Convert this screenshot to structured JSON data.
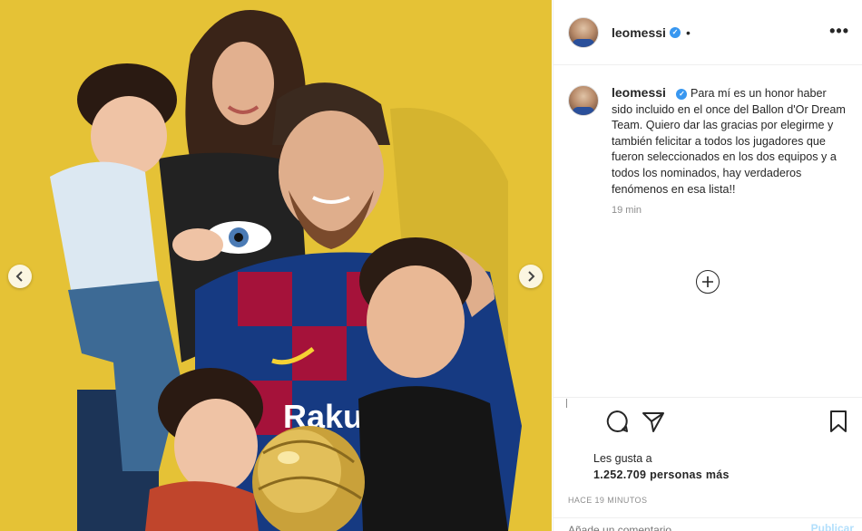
{
  "post": {
    "username": "leomessi",
    "verified_mark": "✓",
    "separator": "•",
    "more_label": "•••",
    "caption": "Para mí es un honor haber sido incluido en el once del Ballon d'Or Dream Team. Quiero dar las gracias por elegirme y también felicitar a todos los jugadores que fueron seleccionados en los dos equipos y a todos los nominados, hay verdaderos fenómenos en esa lista!!",
    "caption_time": "19 min",
    "likes_prefix": "Les gusta a",
    "likes_count": "1.252.709 personas más",
    "posted_ago": "HACE 19 MINUTOS",
    "comment_placeholder": "Añade un comentario...",
    "publish_label": "Publicar"
  },
  "photo": {
    "jersey_text": "Rakuten",
    "background_color": "#e6c33a"
  },
  "icons": {
    "prev": "chevron-left-icon",
    "next": "chevron-right-icon",
    "comment": "comment-icon",
    "share": "share-icon",
    "save": "bookmark-icon",
    "load_more": "plus-circle-icon",
    "more": "more-options-icon"
  }
}
